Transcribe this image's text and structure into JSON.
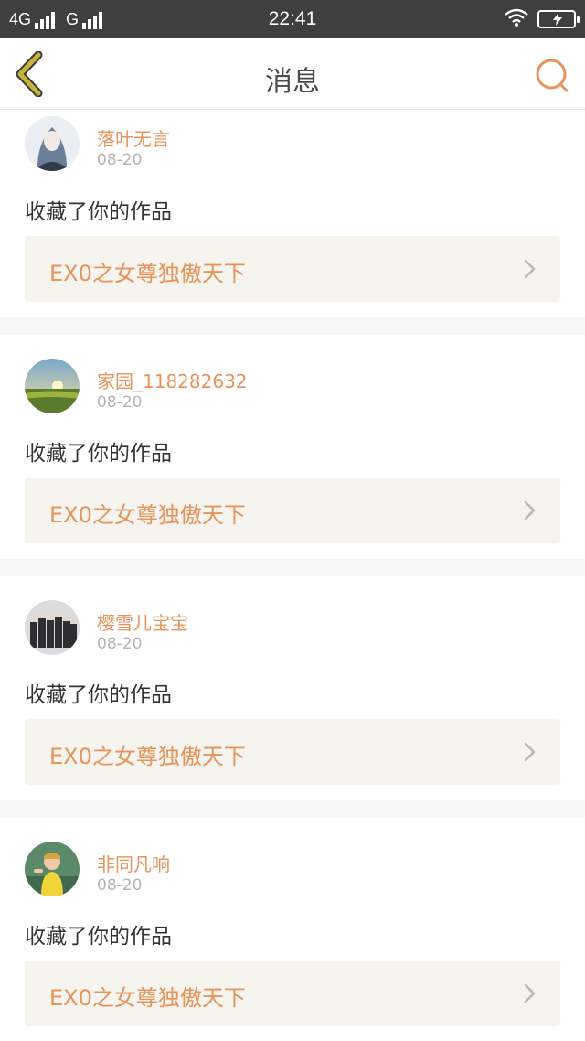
{
  "status_bar": {
    "network1": "4G",
    "network2": "G",
    "time": "22:41"
  },
  "header": {
    "title": "消息",
    "back_icon": "chevron-left-icon",
    "search_icon": "search-icon"
  },
  "colors": {
    "accent": "#e8935a",
    "back_arrow": "#c9b13a",
    "card_bg": "#f5f4ee",
    "separator": "#f7f7f7"
  },
  "messages": [
    {
      "user": "落叶无言",
      "date": "08-20",
      "action": "收藏了你的作品",
      "work": "EX0之女尊独傲天下"
    },
    {
      "user": "家园_118282632",
      "date": "08-20",
      "action": "收藏了你的作品",
      "work": "EX0之女尊独傲天下"
    },
    {
      "user": "樱雪儿宝宝",
      "date": "08-20",
      "action": "收藏了你的作品",
      "work": "EX0之女尊独傲天下"
    },
    {
      "user": "非同凡响",
      "date": "08-20",
      "action": "收藏了你的作品",
      "work": "EX0之女尊独傲天下"
    }
  ]
}
